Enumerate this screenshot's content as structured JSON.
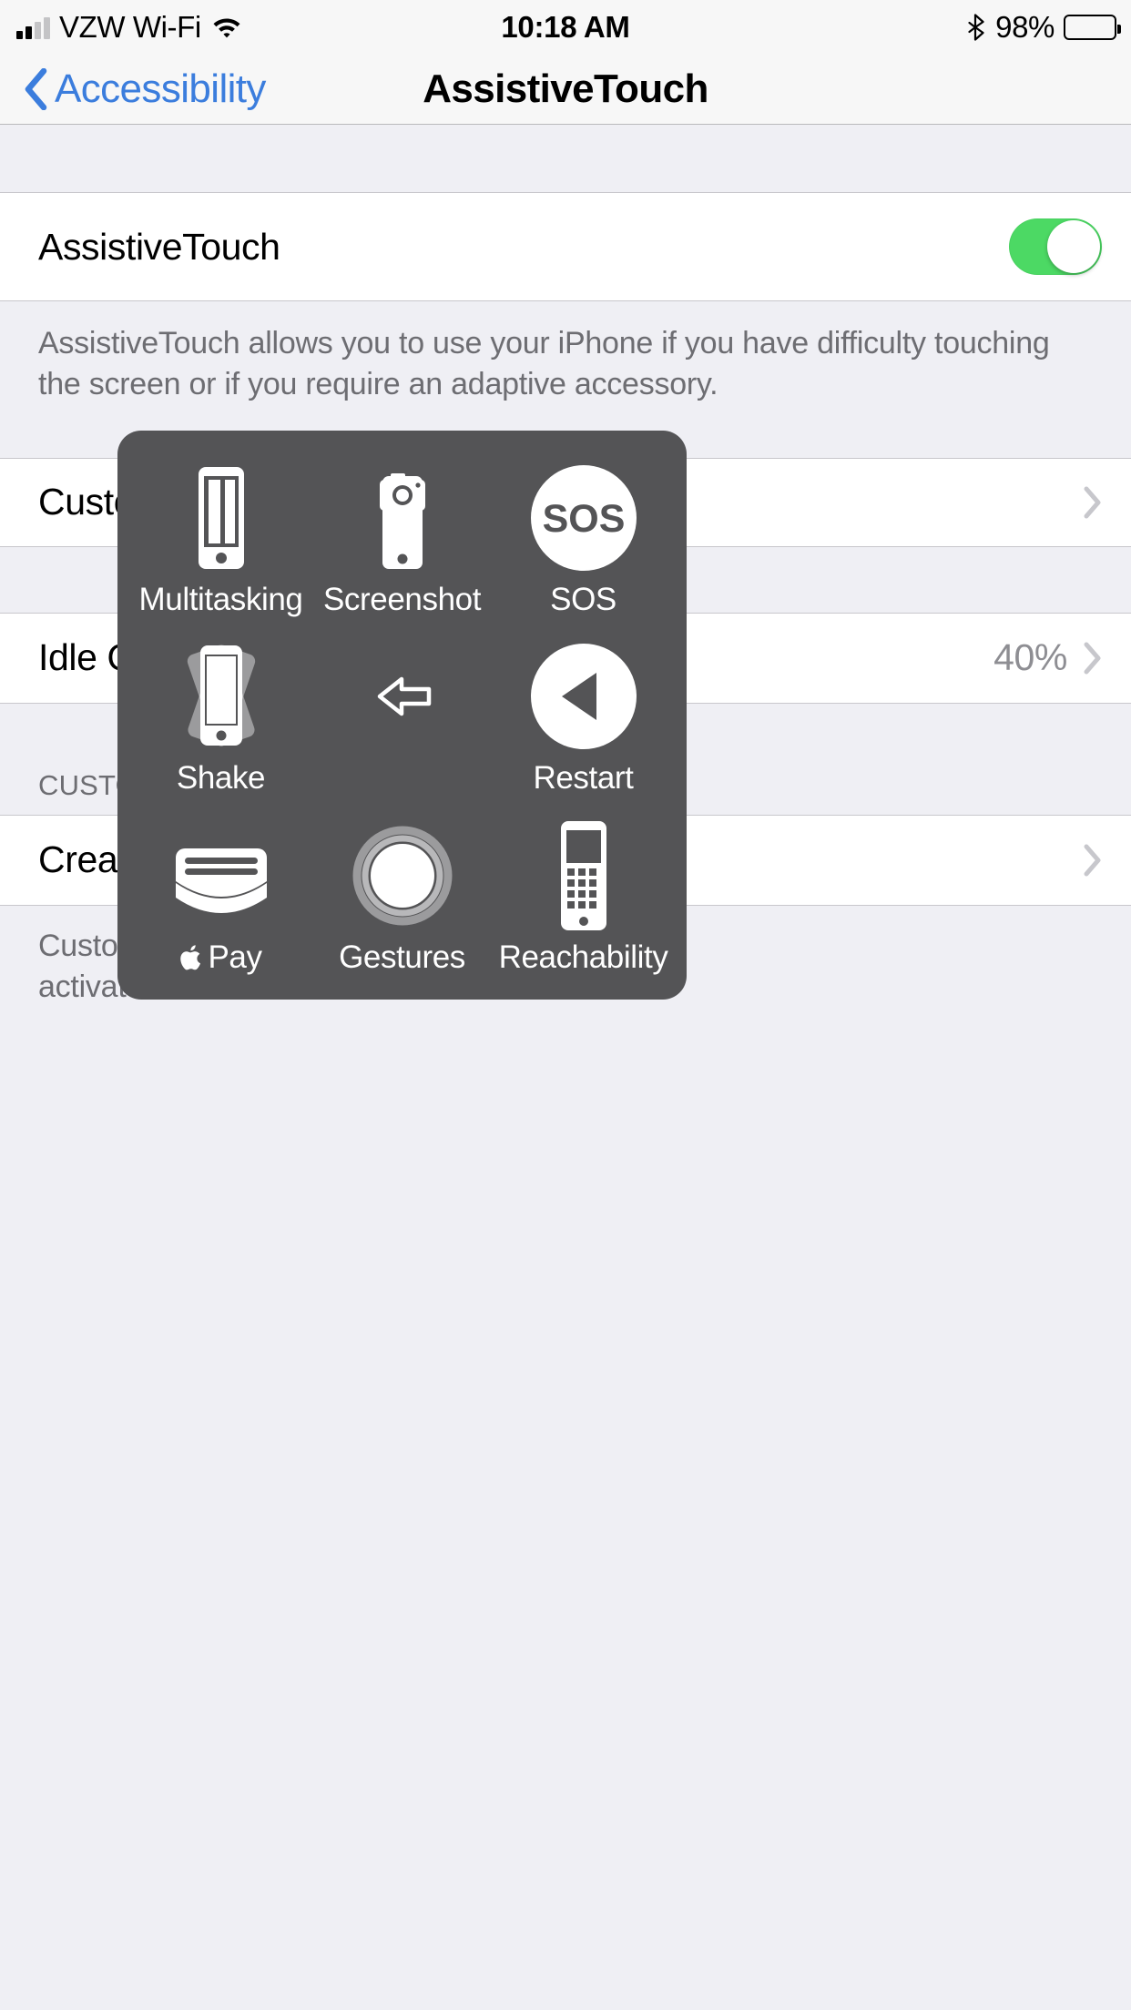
{
  "status_bar": {
    "carrier": "VZW Wi-Fi",
    "signal_bars_filled": 2,
    "signal_bars_total": 4,
    "wifi_icon": "wifi-icon",
    "time": "10:18 AM",
    "bluetooth_icon": "bluetooth-icon",
    "battery_percent": "98%",
    "battery_level": 98
  },
  "nav": {
    "back_icon": "chevron-left-icon",
    "back_label": "Accessibility",
    "title": "AssistiveTouch"
  },
  "settings": {
    "toggle_row": {
      "label": "AssistiveTouch",
      "switch_state": "on",
      "switch_color": "#4cd964"
    },
    "footer": "AssistiveTouch allows you to use your iPhone if you have difficulty touching the screen or if you require an adaptive accessory.",
    "rows": [
      {
        "label": "Customize Top Level Menu",
        "value": "",
        "accessory": "chevron-right-icon"
      },
      {
        "label": "Idle Opacity",
        "value": "40%",
        "accessory": "chevron-right-icon"
      }
    ],
    "group_header": "CUSTOM ACTIONS",
    "custom_rows": [
      {
        "label": "Create New Gesture...",
        "value": "",
        "accessory": "chevron-right-icon"
      }
    ],
    "custom_footer_line1": "Custom gestures can be recorded and",
    "custom_footer_line2": "activated from the AssistiveTouch menu."
  },
  "assistive_touch_menu": {
    "background_color": "#545456",
    "items": [
      {
        "label": "Multitasking",
        "icon": "multitasking-icon"
      },
      {
        "label": "Screenshot",
        "icon": "screenshot-icon"
      },
      {
        "label": "SOS",
        "icon": "sos-icon"
      },
      {
        "label": "Shake",
        "icon": "shake-icon"
      },
      {
        "label": "",
        "icon": "back-arrow-icon"
      },
      {
        "label": "Restart",
        "icon": "restart-icon"
      },
      {
        "label": "Pay",
        "icon": "apple-pay-icon"
      },
      {
        "label": "Gestures",
        "icon": "gestures-icon"
      },
      {
        "label": "Reachability",
        "icon": "reachability-icon"
      }
    ]
  }
}
